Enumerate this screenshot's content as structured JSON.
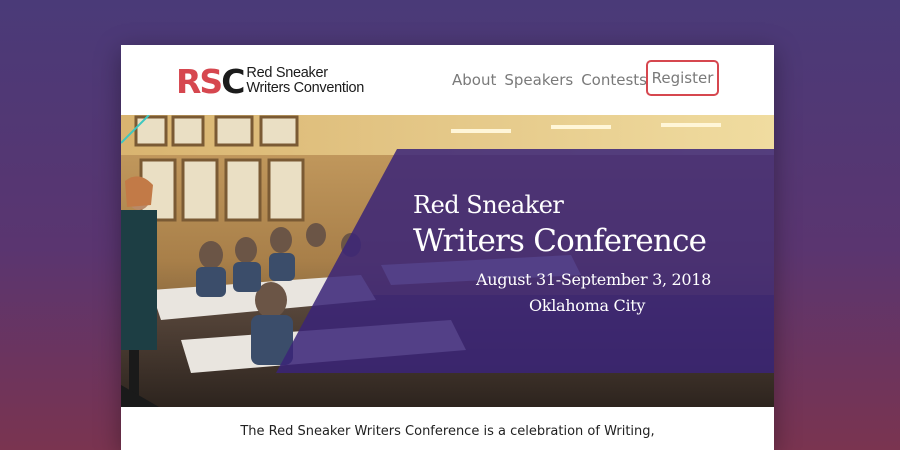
{
  "logo": {
    "mark_red": "RS",
    "mark_dark": "C",
    "line1": "Red Sneaker",
    "line2": "Writers Convention"
  },
  "nav": {
    "items": [
      "About",
      "Speakers",
      "Contests"
    ],
    "register_label": "Register"
  },
  "hero": {
    "subtitle": "Red Sneaker",
    "title": "Writers Conference",
    "dates": "August 31-September 3, 2018",
    "city": "Oklahoma City"
  },
  "intro": {
    "line1": "The Red Sneaker Writers Conference is a celebration of Writing,"
  },
  "colors": {
    "accent_red": "#d6474f",
    "overlay_purple": "#3a2478",
    "background_top": "#4a3a78",
    "background_bottom": "#7a3450"
  }
}
